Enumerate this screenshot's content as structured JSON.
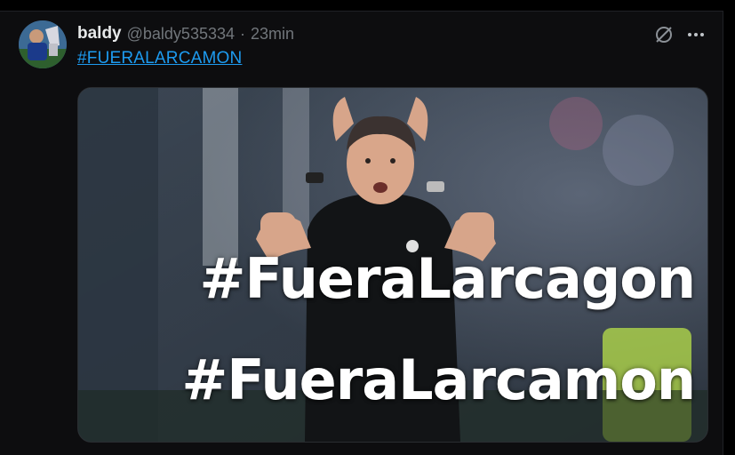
{
  "post": {
    "display_name": "baldy",
    "handle": "@baldy535334",
    "separator": "·",
    "time": "23min",
    "hashtag_link": "#FUERALARCAMON",
    "icons": {
      "grok": "grok-slash-icon",
      "more": "more-dots-icon"
    }
  },
  "media": {
    "caption_line_1": "#FueraLarcagon",
    "caption_line_2": "#FueraLarcamon"
  },
  "colors": {
    "link": "#1d9bf0",
    "background": "#0d0d0f",
    "muted": "#71767b"
  }
}
